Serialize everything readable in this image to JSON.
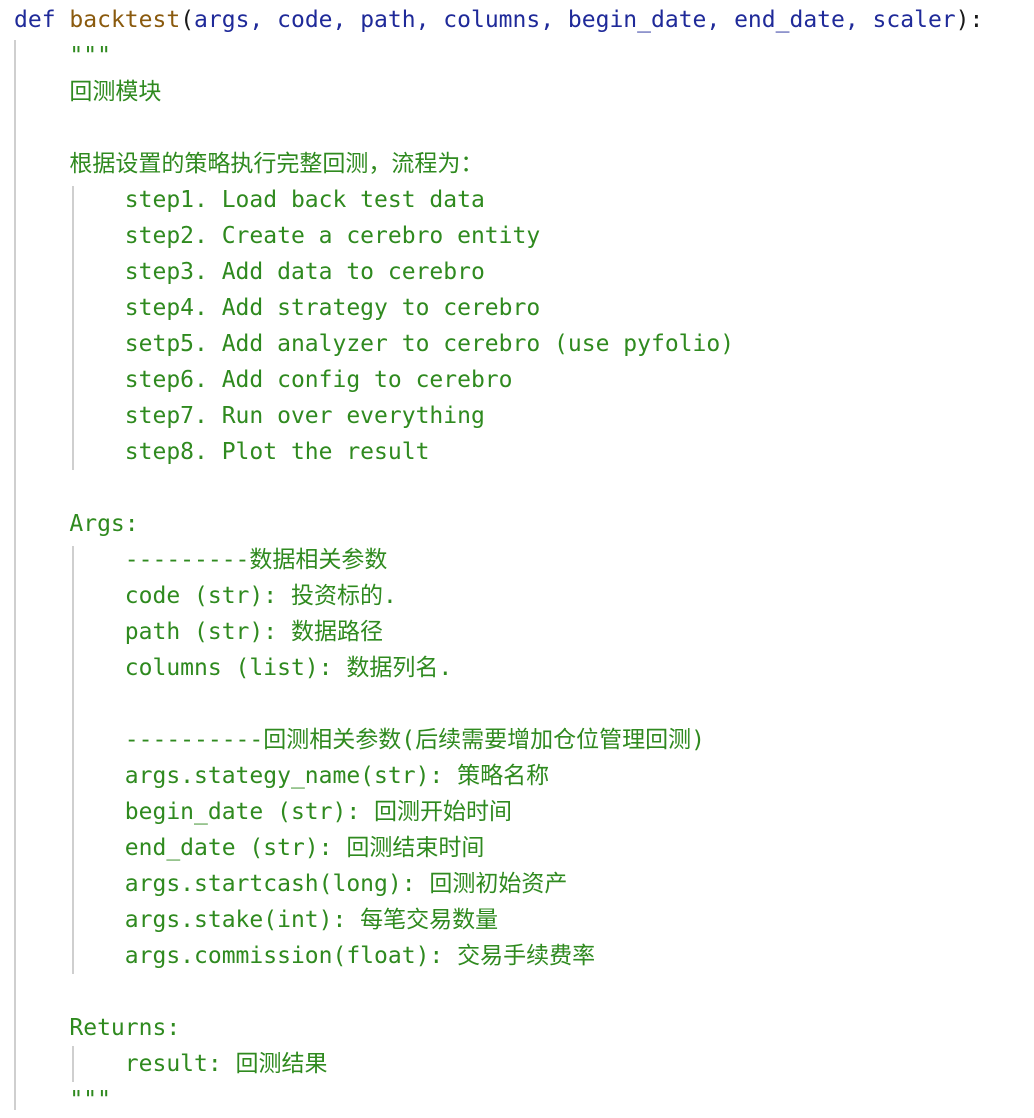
{
  "code_editor": {
    "signature": {
      "keyword": "def",
      "function_name": "backtest",
      "open_paren": "(",
      "params_text": "args, code, path, columns, begin_date, end_date, scaler",
      "close": "):"
    },
    "docstring_lines": [
      "    \"\"\"",
      "    回测模块",
      "",
      "    根据设置的策略执行完整回测，流程为：",
      "        step1. Load back test data",
      "        step2. Create a cerebro entity",
      "        step3. Add data to cerebro",
      "        step4. Add strategy to cerebro",
      "        setp5. Add analyzer to cerebro (use pyfolio)",
      "        step6. Add config to cerebro",
      "        step7. Run over everything",
      "        step8. Plot the result",
      "",
      "    Args:",
      "        ---------数据相关参数",
      "        code (str): 投资标的.",
      "        path (str): 数据路径",
      "        columns (list): 数据列名.",
      "",
      "        ----------回测相关参数(后续需要增加仓位管理回测)",
      "        args.stategy_name(str): 策略名称",
      "        begin_date (str): 回测开始时间",
      "        end_date (str): 回测结束时间",
      "        args.startcash(long): 回测初始资产",
      "        args.stake(int): 每笔交易数量",
      "        args.commission(float): 交易手续费率",
      "",
      "    Returns:",
      "        result: 回测结果",
      "    \"\"\""
    ]
  }
}
